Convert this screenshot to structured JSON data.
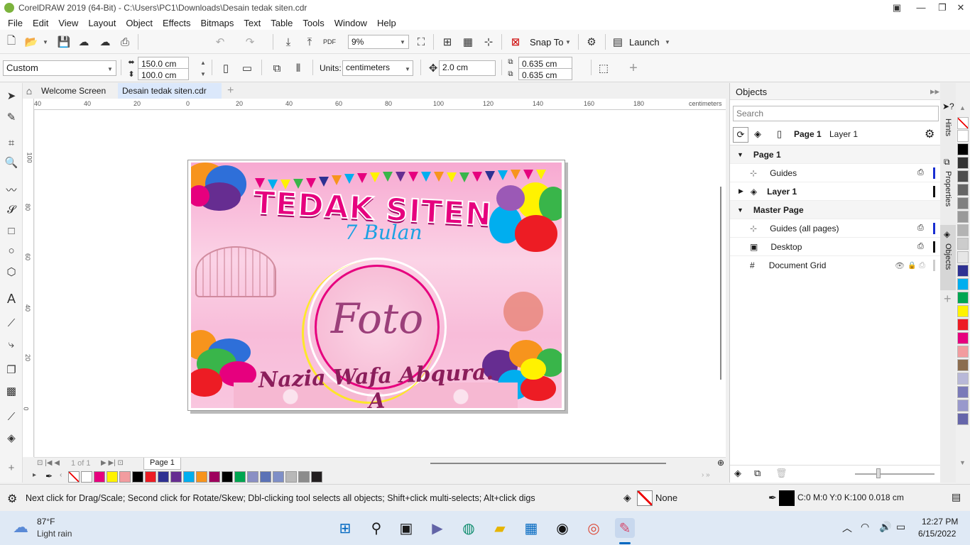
{
  "window": {
    "title": "CorelDRAW 2019 (64-Bit) - C:\\Users\\PC1\\Downloads\\Desain tedak siten.cdr"
  },
  "menu": [
    "File",
    "Edit",
    "View",
    "Layout",
    "Object",
    "Effects",
    "Bitmaps",
    "Text",
    "Table",
    "Tools",
    "Window",
    "Help"
  ],
  "toolbar": {
    "zoom": "9%",
    "snap_to": "Snap To",
    "launch": "Launch"
  },
  "property_bar": {
    "preset": "Custom",
    "width": "150.0 cm",
    "height": "100.0 cm",
    "units_label": "Units:",
    "units": "centimeters",
    "nudge": "2.0 cm",
    "dup_x": "0.635 cm",
    "dup_y": "0.635 cm"
  },
  "tabs": {
    "welcome": "Welcome Screen",
    "document": "Desain tedak siten.cdr"
  },
  "ruler": {
    "h_ticks": [
      "40",
      "20",
      "0",
      "20",
      "40",
      "60",
      "80",
      "100",
      "120",
      "140",
      "160",
      "180"
    ],
    "h_first": "40",
    "unit": "centimeters",
    "v_ticks": [
      "100",
      "80",
      "60",
      "40",
      "20",
      "0"
    ]
  },
  "design": {
    "title": "TEDAK SITEN",
    "subtitle": "7 Bulan",
    "photo": "Foto",
    "name": "Nazia Wafa Abqura. A"
  },
  "page_nav": {
    "counter": "1 of 1",
    "page_tab": "Page 1"
  },
  "palette": {
    "bottom": [
      "#ffffff",
      "#e6007e",
      "#fff200",
      "#f29c9f",
      "#000000",
      "#ed1c24",
      "#2e3192",
      "#662d91",
      "#00aeef",
      "#f7941d",
      "#9e005d",
      "#000000",
      "#00a651",
      "#8a8fc4",
      "#5b72b6",
      "#7f8fc7",
      "#b8b8b8",
      "#8c8c8c",
      "#231f20"
    ],
    "right": [
      "#ffffff",
      "#000000",
      "#333333",
      "#4d4d4d",
      "#666666",
      "#808080",
      "#999999",
      "#b3b3b3",
      "#cccccc",
      "#e6e6e6",
      "#2e3192",
      "#00aeef",
      "#00a651",
      "#fff200",
      "#ed1c24",
      "#e6007e",
      "#f29c9f",
      "#8b6d4f",
      "#b8b8d8",
      "#7a7ab8",
      "#9999cc",
      "#6666aa"
    ]
  },
  "objects_docker": {
    "title": "Objects",
    "search_placeholder": "Search",
    "page_label": "Page 1",
    "layer_label": "Layer 1",
    "rows": [
      {
        "label": "Page 1",
        "bold": true
      },
      {
        "label": "Guides"
      },
      {
        "label": "Layer 1",
        "bold": true
      },
      {
        "label": "Master Page",
        "bold": true
      },
      {
        "label": "Guides (all pages)"
      },
      {
        "label": "Desktop"
      },
      {
        "label": "Document Grid"
      }
    ]
  },
  "side_tabs": [
    "Hints",
    "Properties",
    "Objects"
  ],
  "status": {
    "hint": "Next click for Drag/Scale; Second click for Rotate/Skew; Dbl-clicking tool selects all objects; Shift+click multi-selects; Alt+click digs",
    "fill": "None",
    "outline": "C:0 M:0 Y:0 K:100  0.018 cm"
  },
  "taskbar": {
    "weather_temp": "87°F",
    "weather_desc": "Light rain",
    "time": "12:27 PM",
    "date": "6/15/2022"
  }
}
